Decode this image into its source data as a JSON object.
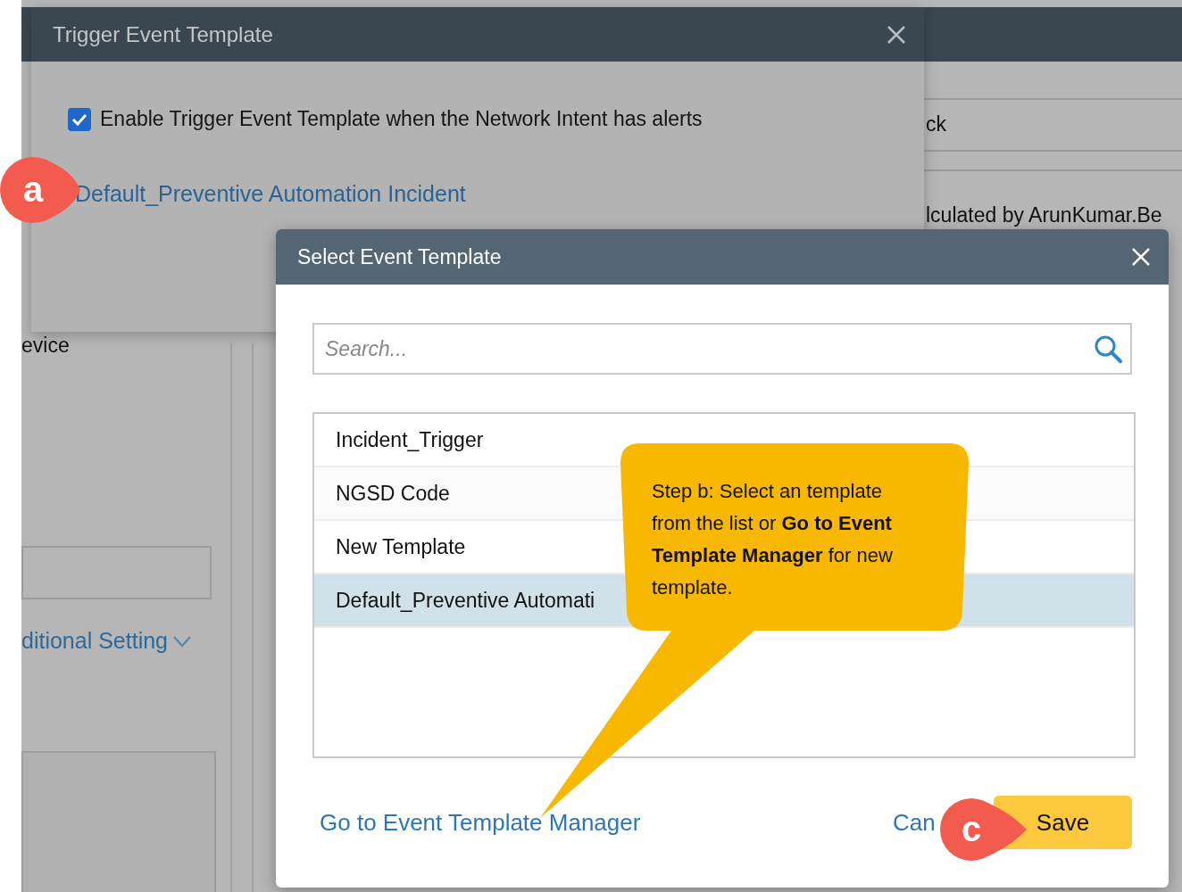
{
  "background_page": {
    "fragments": [
      "ck",
      "lculated by ArunKumar.Be",
      "evice"
    ],
    "section_link": "ditional Setting"
  },
  "trigger_dialog": {
    "title": "Trigger Event Template",
    "enable_checkbox": {
      "label": "Enable Trigger Event Template when the Network Intent has alerts",
      "checked": true
    },
    "template_link": "Default_Preventive Automation Incident"
  },
  "select_dialog": {
    "title": "Select Event Template",
    "search": {
      "placeholder": "Search..."
    },
    "templates": [
      {
        "name": "Incident_Trigger",
        "selected": false
      },
      {
        "name": "NGSD Code",
        "selected": false
      },
      {
        "name": "New Template",
        "selected": false
      },
      {
        "name": "Default_Preventive Automati",
        "selected": true
      }
    ],
    "manager_link": "Go to Event Template Manager",
    "cancel_button": "Can",
    "save_button": "Save"
  },
  "callout": {
    "text": "Step b: Select an template from the list or **Go to Event Template Manager** for new template."
  },
  "markers": [
    {
      "label": "a"
    },
    {
      "label": "c"
    }
  ]
}
